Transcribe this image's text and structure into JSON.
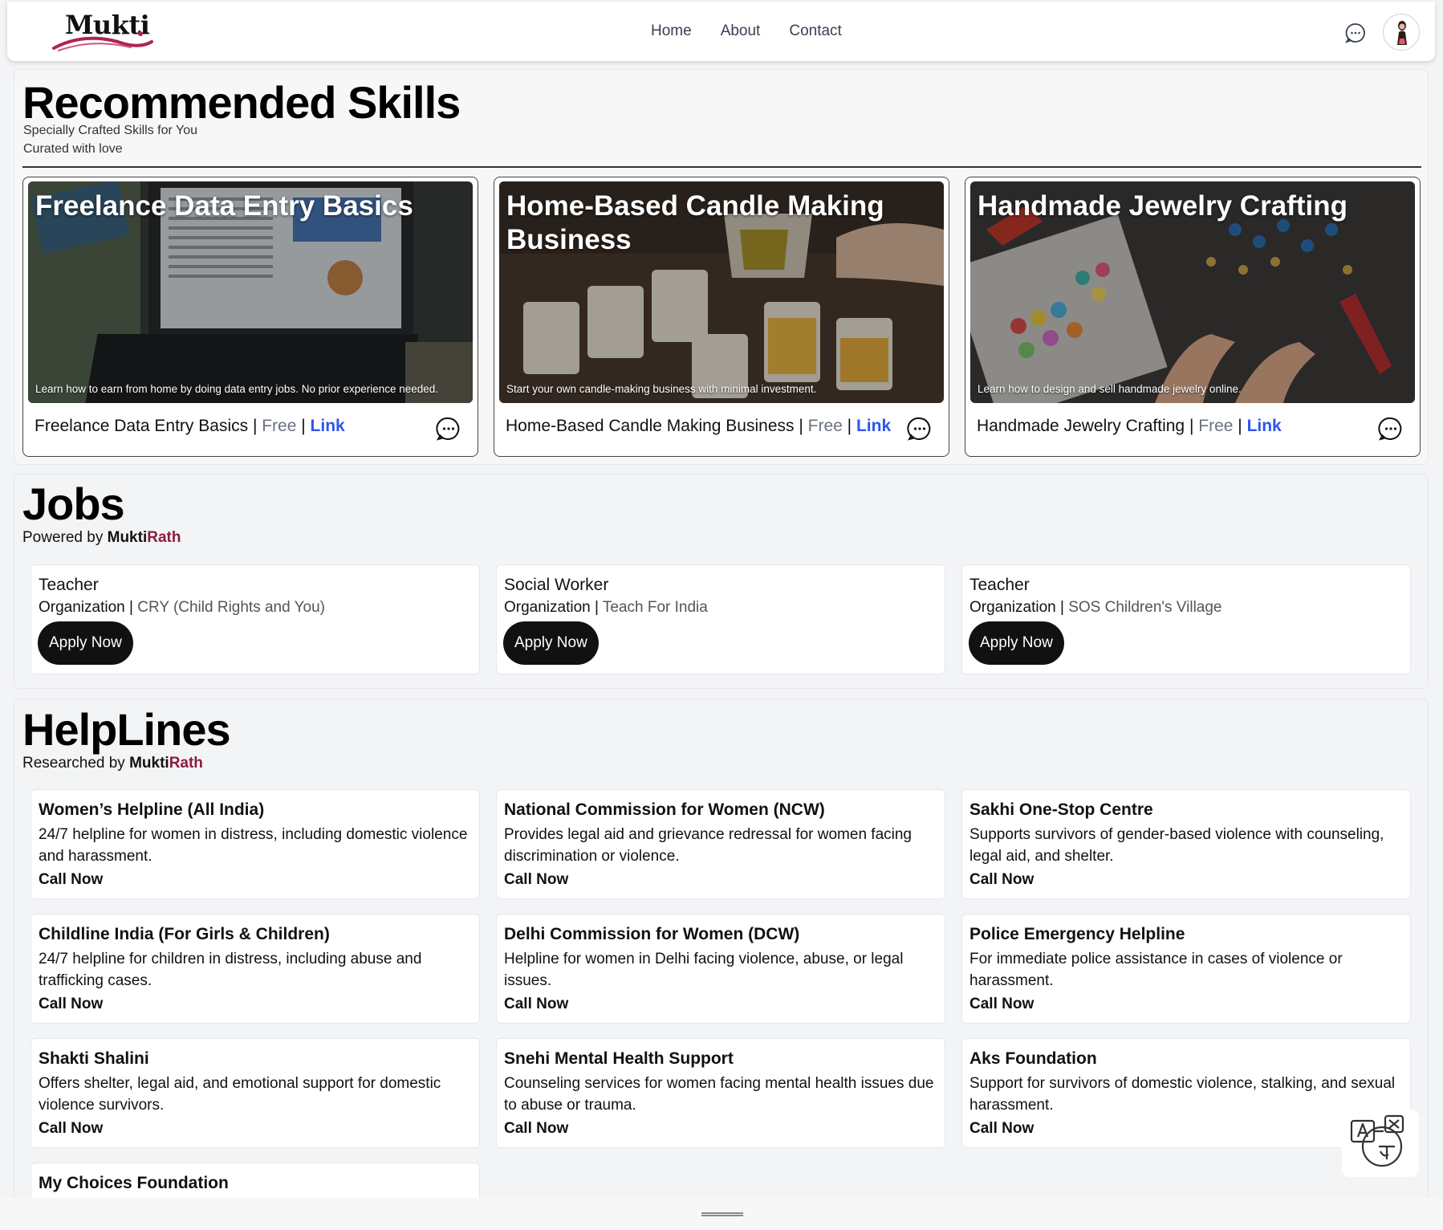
{
  "nav": {
    "logo_text": "Mukti",
    "links": [
      "Home",
      "About",
      "Contact"
    ],
    "chat_icon": "chat-bubble-icon",
    "avatar_icon": "user-avatar"
  },
  "skills": {
    "title": "Recommended Skills",
    "subtitle1": "Specially Crafted Skills for You",
    "subtitle2": "Curated with love",
    "cards": [
      {
        "title": "Freelance Data Entry Basics",
        "desc": "Learn how to earn from home by doing data entry jobs. No prior experience needed.",
        "price": "Free",
        "link": "Link",
        "sep": " | "
      },
      {
        "title": "Home-Based Candle Making Business",
        "desc": "Start your own candle-making business with minimal investment.",
        "price": "Free",
        "link": "Link",
        "sep": " | "
      },
      {
        "title": "Handmade Jewelry Crafting",
        "desc": "Learn how to design and sell handmade jewelry online.",
        "price": "Free",
        "link": "Link",
        "sep": " | "
      }
    ]
  },
  "jobs": {
    "title": "Jobs",
    "powered_prefix": "Powered by",
    "brand_a": "Mukti",
    "brand_b": "Rath",
    "org_label": "Organization | ",
    "apply_label": "Apply Now",
    "items": [
      {
        "title": "Teacher",
        "org": "CRY (Child Rights and You)"
      },
      {
        "title": "Social Worker",
        "org": "Teach For India"
      },
      {
        "title": "Teacher",
        "org": "SOS Children's Village"
      }
    ]
  },
  "helplines": {
    "title": "HelpLines",
    "researched_prefix": "Researched by",
    "brand_a": "Mukti",
    "brand_b": "Rath",
    "call_label": "Call Now",
    "items": [
      {
        "title": "Women’s Helpline (All India)",
        "desc": "24/7 helpline for women in distress, including domestic violence and harassment."
      },
      {
        "title": "National Commission for Women (NCW)",
        "desc": "Provides legal aid and grievance redressal for women facing discrimination or violence."
      },
      {
        "title": "Sakhi One-Stop Centre",
        "desc": "Supports survivors of gender-based violence with counseling, legal aid, and shelter."
      },
      {
        "title": "Childline India (For Girls & Children)",
        "desc": "24/7 helpline for children in distress, including abuse and trafficking cases."
      },
      {
        "title": "Delhi Commission for Women (DCW)",
        "desc": "Helpline for women in Delhi facing violence, abuse, or legal issues."
      },
      {
        "title": "Police Emergency Helpline",
        "desc": "For immediate police assistance in cases of violence or harassment."
      },
      {
        "title": "Shakti Shalini",
        "desc": "Offers shelter, legal aid, and emotional support for domestic violence survivors."
      },
      {
        "title": "Snehi Mental Health Support",
        "desc": "Counseling services for women facing mental health issues due to abuse or trauma."
      },
      {
        "title": "Aks Foundation",
        "desc": "Support for survivors of domestic violence, stalking, and sexual harassment."
      },
      {
        "title": "My Choices Foundation",
        "desc": ""
      }
    ]
  },
  "translate_icon": "translate-icon"
}
